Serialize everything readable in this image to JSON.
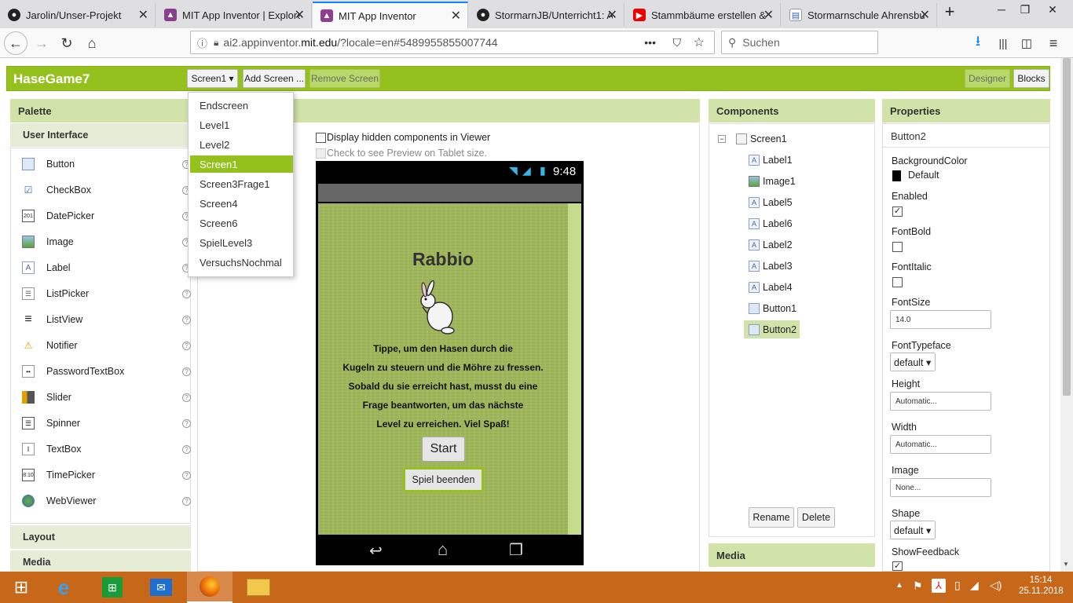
{
  "browser": {
    "tabs": [
      {
        "title": "Jarolin/Unser-Projekt",
        "icon": "github-icon"
      },
      {
        "title": "MIT App Inventor | Explore",
        "icon": "appinventor-icon"
      },
      {
        "title": "MIT App Inventor",
        "icon": "appinventor-icon",
        "active": true
      },
      {
        "title": "StormarnJB/Unterricht1: A",
        "icon": "github-icon"
      },
      {
        "title": "Stammbäume erstellen &",
        "icon": "youtube-icon"
      },
      {
        "title": "Stormarnschule Ahrensbu",
        "icon": "page-icon"
      }
    ],
    "url_prefix": "ai2.appinventor.",
    "url_domain": "mit.edu",
    "url_suffix": "/?locale=en#5489955855007744",
    "search_placeholder": "Suchen"
  },
  "app": {
    "project_name": "HaseGame7",
    "screen_select": "Screen1 ▾",
    "add_screen": "Add Screen ...",
    "remove_screen": "Remove Screen",
    "designer": "Designer",
    "blocks": "Blocks"
  },
  "palette": {
    "title": "Palette",
    "section": "User Interface",
    "items": [
      {
        "label": "Button",
        "icon": "button-icon"
      },
      {
        "label": "CheckBox",
        "icon": "checkbox-icon"
      },
      {
        "label": "DatePicker",
        "icon": "datepicker-icon"
      },
      {
        "label": "Image",
        "icon": "image-icon"
      },
      {
        "label": "Label",
        "icon": "label-icon"
      },
      {
        "label": "ListPicker",
        "icon": "listpicker-icon"
      },
      {
        "label": "ListView",
        "icon": "listview-icon"
      },
      {
        "label": "Notifier",
        "icon": "notifier-icon"
      },
      {
        "label": "PasswordTextBox",
        "icon": "password-icon"
      },
      {
        "label": "Slider",
        "icon": "slider-icon"
      },
      {
        "label": "Spinner",
        "icon": "spinner-icon"
      },
      {
        "label": "TextBox",
        "icon": "textbox-icon"
      },
      {
        "label": "TimePicker",
        "icon": "timepicker-icon"
      },
      {
        "label": "WebViewer",
        "icon": "webviewer-icon"
      }
    ],
    "layout": "Layout",
    "media": "Media"
  },
  "dropdown": {
    "items": [
      "Endscreen",
      "Level1",
      "Level2",
      "Screen1",
      "Screen3Frage1",
      "Screen4",
      "Screen6",
      "SpielLevel3",
      "VersuchsNochmal"
    ],
    "selected_index": 3
  },
  "viewer": {
    "display_hidden": "Display hidden components in Viewer",
    "tablet_preview": "Check to see Preview on Tablet size.",
    "status_time": "9:48",
    "title": "Rabbio",
    "lines": [
      "Tippe, um den Hasen durch die",
      "Kugeln zu steuern und die Möhre zu fressen.",
      "Sobald du sie erreicht hast, musst du eine",
      "Frage beantworten, um das nächste",
      "Level zu erreichen. Viel Spaß!"
    ],
    "start": "Start",
    "quit": "Spiel beenden"
  },
  "components": {
    "title": "Components",
    "root": "Screen1",
    "items": [
      "Label1",
      "Image1",
      "Label5",
      "Label6",
      "Label2",
      "Label3",
      "Label4",
      "Button1",
      "Button2"
    ],
    "selected": "Button2",
    "rename": "Rename",
    "delete": "Delete",
    "media": "Media"
  },
  "properties": {
    "title": "Properties",
    "component": "Button2",
    "background_color_label": "BackgroundColor",
    "background_color_value": "Default",
    "enabled_label": "Enabled",
    "fontbold_label": "FontBold",
    "fontitalic_label": "FontItalic",
    "fontsize_label": "FontSize",
    "fontsize_value": "14.0",
    "fonttypeface_label": "FontTypeface",
    "fonttypeface_value": "default ▾",
    "height_label": "Height",
    "height_value": "Automatic...",
    "width_label": "Width",
    "width_value": "Automatic...",
    "image_label": "Image",
    "image_value": "None...",
    "shape_label": "Shape",
    "shape_value": "default ▾",
    "showfeedback_label": "ShowFeedback"
  },
  "taskbar": {
    "time": "15:14",
    "date": "25.11.2018"
  },
  "colors": {
    "accent": "#95c11f",
    "panel_head": "#d1e3a8",
    "taskbar": "#c7671a"
  }
}
